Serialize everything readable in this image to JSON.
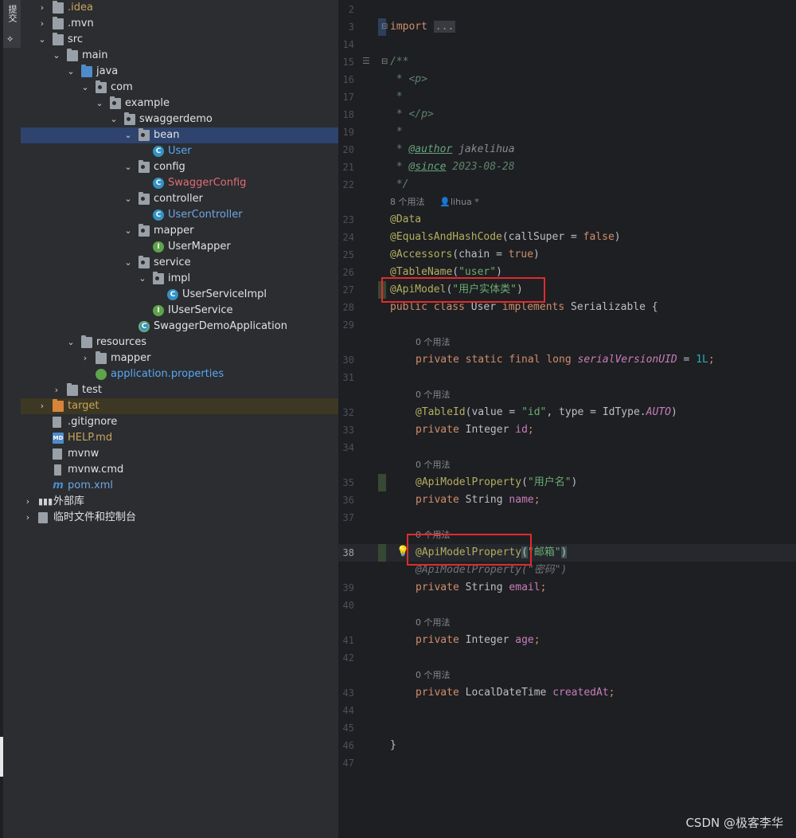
{
  "sidebar": {
    "commit_tab": "提交"
  },
  "tree": {
    "items": [
      {
        "label": ".idea"
      },
      {
        "label": ".mvn"
      },
      {
        "label": "src"
      },
      {
        "label": "main"
      },
      {
        "label": "java"
      },
      {
        "label": "com"
      },
      {
        "label": "example"
      },
      {
        "label": "swaggerdemo"
      },
      {
        "label": "bean"
      },
      {
        "label": "User"
      },
      {
        "label": "config"
      },
      {
        "label": "SwaggerConfig"
      },
      {
        "label": "controller"
      },
      {
        "label": "UserController"
      },
      {
        "label": "mapper"
      },
      {
        "label": "UserMapper"
      },
      {
        "label": "service"
      },
      {
        "label": "impl"
      },
      {
        "label": "UserServiceImpl"
      },
      {
        "label": "IUserService"
      },
      {
        "label": "SwaggerDemoApplication"
      },
      {
        "label": "resources"
      },
      {
        "label": "mapper"
      },
      {
        "label": "application.properties"
      },
      {
        "label": "test"
      },
      {
        "label": "target"
      },
      {
        "label": ".gitignore"
      },
      {
        "label": "HELP.md"
      },
      {
        "label": "mvnw"
      },
      {
        "label": "mvnw.cmd"
      },
      {
        "label": "pom.xml"
      },
      {
        "label": "外部库"
      },
      {
        "label": "临时文件和控制台"
      }
    ]
  },
  "editor": {
    "line_numbers": [
      "2",
      "3",
      "14",
      "15",
      "16",
      "17",
      "18",
      "19",
      "20",
      "21",
      "22",
      "23",
      "24",
      "25",
      "26",
      "27",
      "28",
      "29",
      "30",
      "31",
      "32",
      "33",
      "34",
      "35",
      "36",
      "37",
      "38",
      "39",
      "40",
      "41",
      "42",
      "43",
      "44",
      "45",
      "46",
      "47"
    ],
    "import_kw": "import",
    "import_fold": "...",
    "doc_open": "/**",
    "doc_p": " * <p>",
    "doc_star": " *",
    "doc_p_close": " * </p>",
    "doc_star2": " *",
    "doc_author_prefix": " * ",
    "doc_author_tag": "@author",
    "doc_author_val": " jakelihua",
    "doc_since_prefix": " * ",
    "doc_since_tag": "@since",
    "doc_since_val": " 2023-08-28",
    "doc_close": " */",
    "usage_class": "8 个用法",
    "usage_author": "lihua *",
    "anno_data": "@Data",
    "anno_equals": "@EqualsAndHashCode",
    "anno_equals_args_a": "(callSuper = ",
    "anno_equals_false": "false",
    "anno_equals_close": ")",
    "anno_accessors": "@Accessors",
    "anno_accessors_args_a": "(chain = ",
    "anno_accessors_true": "true",
    "anno_accessors_close": ")",
    "anno_tablename": "@TableName",
    "anno_tablename_open": "(",
    "anno_tablename_str": "\"user\"",
    "anno_tablename_close": ")",
    "anno_apimodel": "@ApiModel",
    "anno_apimodel_open": "(",
    "anno_apimodel_str": "\"用户实体类\"",
    "anno_apimodel_close": ")",
    "class_public": "public",
    "class_class": " class",
    "class_name": " User",
    "class_implements": " implements",
    "class_iface": " Serializable {",
    "usage_0": "0 个用法",
    "f1_mods": "private static final long",
    "f1_name": " serialVersionUID",
    "f1_eq": " = ",
    "f1_val": "1L",
    "f1_semi": ";",
    "f2_anno": "@TableId",
    "f2_open": "(value = ",
    "f2_str": "\"id\"",
    "f2_mid": ", type = IdType.",
    "f2_const": "AUTO",
    "f2_close": ")",
    "f2_mod": "private",
    "f2_type": " Integer ",
    "f2_name": "id",
    "f2_semi": ";",
    "f3_anno": "@ApiModelProperty",
    "f3_open": "(",
    "f3_str": "\"用户名\"",
    "f3_close": ")",
    "f3_mod": "private",
    "f3_type": " String ",
    "f3_name": "name",
    "f3_semi": ";",
    "f4_anno": "@ApiModelProperty",
    "f4_open": "(",
    "f4_str": "\"邮箱\"",
    "f4_close": ")",
    "f4_ghost": "@ApiModelProperty(\"密码\")",
    "f4_mod": "private",
    "f4_type": " String ",
    "f4_name": "email",
    "f4_semi": ";",
    "f5_mod": "private",
    "f5_type": " Integer ",
    "f5_name": "age",
    "f5_semi": ";",
    "f6_mod": "private",
    "f6_type": " LocalDateTime ",
    "f6_name": "createdAt",
    "f6_semi": ";",
    "closing_brace": "}"
  },
  "watermark": "CSDN @极客李华",
  "colors": {
    "keyword": "#cf8e6d",
    "annotation": "#b3ae60",
    "string": "#6aab73",
    "field": "#c77dbb",
    "highlight_box": "#e02b2b"
  }
}
